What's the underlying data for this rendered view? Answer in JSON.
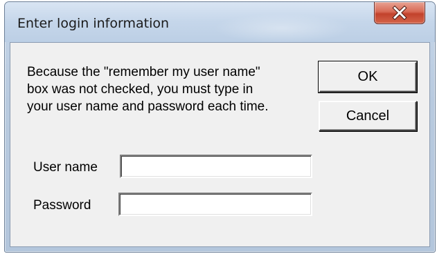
{
  "window": {
    "title": "Enter login information",
    "close_icon": "close-icon"
  },
  "message": "Because the \"remember my user name\"\nbox was not checked, you must type in\nyour user name and password each time.",
  "buttons": {
    "ok_label": "OK",
    "cancel_label": "Cancel"
  },
  "fields": {
    "username": {
      "label": "User name",
      "value": "",
      "placeholder": ""
    },
    "password": {
      "label": "Password",
      "value": "",
      "placeholder": ""
    }
  },
  "colors": {
    "close_button": "#c8503a",
    "dialog_background": "#f0f0f0",
    "titlebar": "#c5d6ea"
  }
}
